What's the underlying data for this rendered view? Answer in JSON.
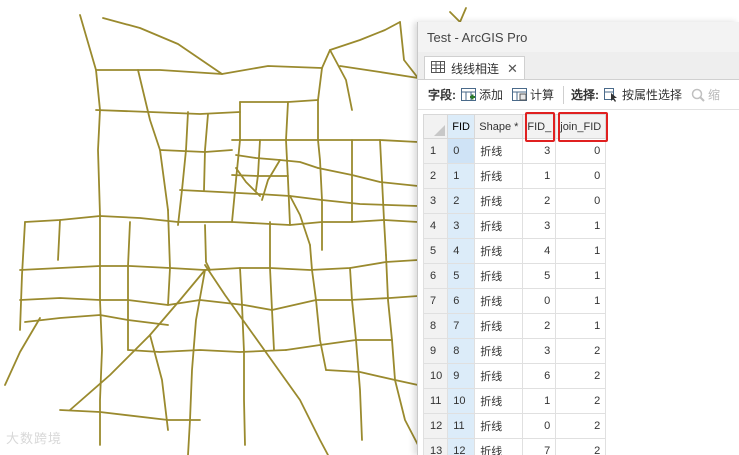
{
  "window": {
    "title": "Test - ArcGIS Pro"
  },
  "tab": {
    "label": "线线相连",
    "icon": "table-icon",
    "close": "✕"
  },
  "toolbar": {
    "fields_label": "字段:",
    "add_label": "添加",
    "calculate_label": "计算",
    "selection_label": "选择:",
    "select_by_attr_label": "按属性选择",
    "zoom_label": "缩"
  },
  "table": {
    "columns": [
      "FID",
      "Shape *",
      "FID_",
      "join_FID"
    ],
    "rows": [
      {
        "n": "1",
        "fid": "0",
        "shape": "折线",
        "fid_": "3",
        "join": "0"
      },
      {
        "n": "2",
        "fid": "1",
        "shape": "折线",
        "fid_": "1",
        "join": "0"
      },
      {
        "n": "3",
        "fid": "2",
        "shape": "折线",
        "fid_": "2",
        "join": "0"
      },
      {
        "n": "4",
        "fid": "3",
        "shape": "折线",
        "fid_": "3",
        "join": "1"
      },
      {
        "n": "5",
        "fid": "4",
        "shape": "折线",
        "fid_": "4",
        "join": "1"
      },
      {
        "n": "6",
        "fid": "5",
        "shape": "折线",
        "fid_": "5",
        "join": "1"
      },
      {
        "n": "7",
        "fid": "6",
        "shape": "折线",
        "fid_": "0",
        "join": "1"
      },
      {
        "n": "8",
        "fid": "7",
        "shape": "折线",
        "fid_": "2",
        "join": "1"
      },
      {
        "n": "9",
        "fid": "8",
        "shape": "折线",
        "fid_": "3",
        "join": "2"
      },
      {
        "n": "10",
        "fid": "9",
        "shape": "折线",
        "fid_": "6",
        "join": "2"
      },
      {
        "n": "11",
        "fid": "10",
        "shape": "折线",
        "fid_": "1",
        "join": "2"
      },
      {
        "n": "12",
        "fid": "11",
        "shape": "折线",
        "fid_": "0",
        "join": "2"
      },
      {
        "n": "13",
        "fid": "12",
        "shape": "折线",
        "fid_": "7",
        "join": "2"
      }
    ]
  },
  "watermark": "大数跨境",
  "colors": {
    "road": "#9a8a2e",
    "highlight": "#e02020",
    "selected_column": "#dcecf9"
  }
}
